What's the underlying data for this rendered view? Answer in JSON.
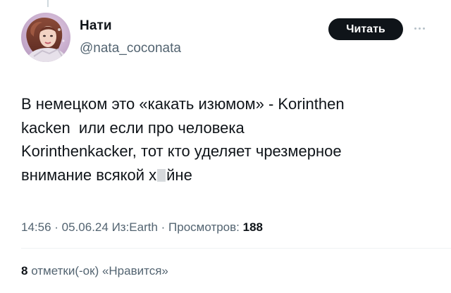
{
  "author": {
    "name": "Нати",
    "handle": "@nata_coconata"
  },
  "follow_button": {
    "label": "Читать"
  },
  "icons": {
    "more": "more-horizontal-icon"
  },
  "tweet": {
    "line1": "В немецком это «какать изюмом» - Korinthen",
    "line2": "kacken  или если про человека",
    "line3": "Korinthenkacker, тот кто уделяет чрезмерное",
    "line4_before": "внимание всякой х",
    "line4_after": "йне"
  },
  "meta": {
    "time": "14:56",
    "sep1": " · ",
    "date": "05.06.24",
    "source": " Из:Earth",
    "sep2": " · ",
    "views_label": "Просмотров: ",
    "views_count": "188"
  },
  "likes": {
    "count": "8",
    "label": " отметки(-ок) «Нравится»"
  },
  "colors": {
    "text": "#0f1419",
    "secondary": "#536471",
    "button_bg": "#0f1419",
    "button_text": "#ffffff"
  }
}
